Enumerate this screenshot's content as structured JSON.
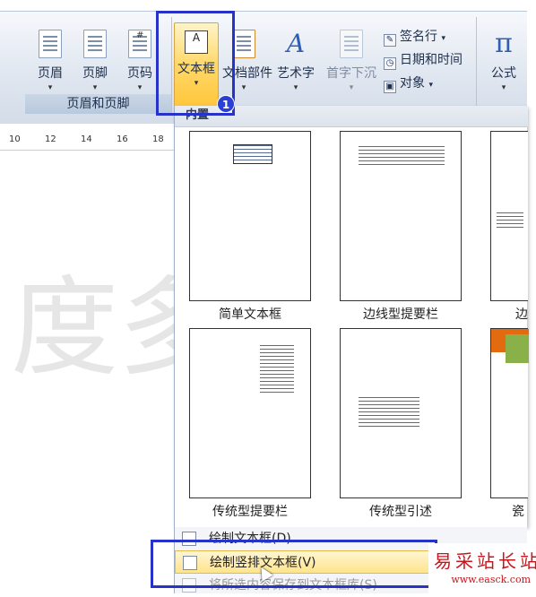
{
  "ribbon": {
    "header_footer_group": {
      "label": "页眉和页脚",
      "buttons": [
        {
          "label": "页眉",
          "icon": "header-icon"
        },
        {
          "label": "页脚",
          "icon": "footer-icon"
        },
        {
          "label": "页码",
          "icon": "page-number-icon"
        }
      ]
    },
    "text_group": {
      "buttons": [
        {
          "label": "文本框",
          "icon": "textbox-icon"
        },
        {
          "label": "文档部件",
          "icon": "quick-parts-icon"
        },
        {
          "label": "艺术字",
          "icon": "wordart-icon"
        },
        {
          "label": "首字下沉",
          "icon": "drop-cap-icon"
        }
      ],
      "small_items": [
        {
          "label": "签名行",
          "icon": "signature-line-icon"
        },
        {
          "label": "日期和时间",
          "icon": "date-time-icon"
        },
        {
          "label": "对象",
          "icon": "object-icon"
        }
      ]
    },
    "symbols_group": {
      "buttons": [
        {
          "label": "公式",
          "icon": "pi-icon",
          "glyph": "π"
        }
      ]
    }
  },
  "ruler": {
    "ticks": [
      "10",
      "12",
      "14",
      "16",
      "18"
    ]
  },
  "watermark": "度多",
  "gallery": {
    "header": "内置",
    "items": [
      {
        "label": "简单文本框"
      },
      {
        "label": "边线型提要栏"
      },
      {
        "label": "边"
      },
      {
        "label": "传统型提要栏"
      },
      {
        "label": "传统型引述"
      },
      {
        "label": "瓷"
      }
    ]
  },
  "menu": {
    "items": [
      {
        "label": "绘制文本框(D)"
      },
      {
        "label": "绘制竖排文本框(V)"
      },
      {
        "label": "将所选内容保存到文本框库(S)"
      }
    ]
  },
  "annotation": {
    "badge": "1"
  },
  "logo": {
    "title": "易采站长站",
    "url": "www.easck.com"
  },
  "colors": {
    "highlight_box": "#2632c8",
    "selected_button": "#ffd86a",
    "logo": "#c4161c"
  }
}
